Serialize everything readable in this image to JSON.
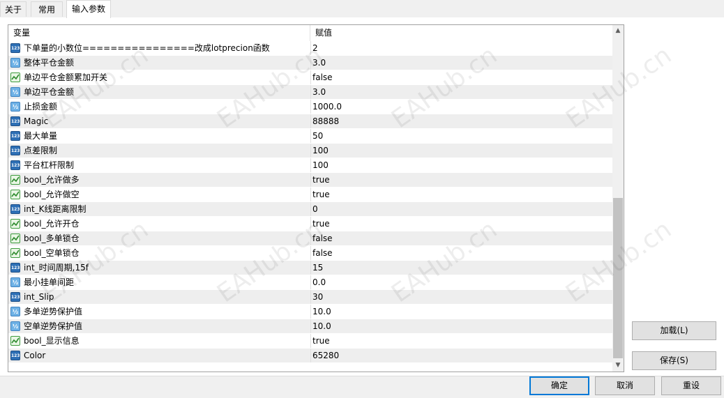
{
  "tabs": [
    {
      "label": "关于"
    },
    {
      "label": "常用"
    },
    {
      "label": "输入参数"
    }
  ],
  "grid": {
    "col_variable": "变量",
    "col_value": "赋值"
  },
  "rows": [
    {
      "type": "int",
      "name": "下单量的小数位================改成lotprecion函数",
      "value": "2"
    },
    {
      "type": "double",
      "name": "整体平仓金额",
      "value": "3.0"
    },
    {
      "type": "bool",
      "name": "单边平仓金额累加开关",
      "value": "false"
    },
    {
      "type": "double",
      "name": "单边平仓金额",
      "value": "3.0"
    },
    {
      "type": "double",
      "name": "止损金额",
      "value": "1000.0"
    },
    {
      "type": "int",
      "name": "Magic",
      "value": "88888"
    },
    {
      "type": "int",
      "name": "最大单量",
      "value": "50"
    },
    {
      "type": "int",
      "name": "点差限制",
      "value": "100"
    },
    {
      "type": "int",
      "name": "平台杠杆限制",
      "value": "100"
    },
    {
      "type": "bool",
      "name": "bool_允许做多",
      "value": "true"
    },
    {
      "type": "bool",
      "name": "bool_允许做空",
      "value": "true"
    },
    {
      "type": "int",
      "name": "int_K线距离限制",
      "value": "0"
    },
    {
      "type": "bool",
      "name": "bool_允许开仓",
      "value": "true"
    },
    {
      "type": "bool",
      "name": "bool_多单锁仓",
      "value": "false"
    },
    {
      "type": "bool",
      "name": "bool_空单锁仓",
      "value": "false"
    },
    {
      "type": "int",
      "name": "int_时间周期,15f",
      "value": "15"
    },
    {
      "type": "double",
      "name": "最小挂单间距",
      "value": "0.0"
    },
    {
      "type": "int",
      "name": "int_Slip",
      "value": "30"
    },
    {
      "type": "double",
      "name": "多单逆势保护值",
      "value": "10.0"
    },
    {
      "type": "double",
      "name": "空单逆势保护值",
      "value": "10.0"
    },
    {
      "type": "bool",
      "name": "bool_显示信息",
      "value": "true"
    },
    {
      "type": "int",
      "name": "Color",
      "value": "65280"
    }
  ],
  "icons": {
    "int": "int-type-icon",
    "double": "double-type-icon",
    "bool": "bool-type-icon"
  },
  "buttons": {
    "load": "加载(L)",
    "save": "保存(S)",
    "ok": "确定",
    "cancel": "取消",
    "reset": "重设"
  },
  "watermark": "EAHub.cn"
}
